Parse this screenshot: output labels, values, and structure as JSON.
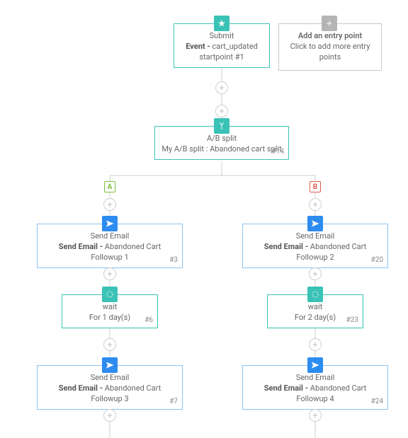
{
  "entry": {
    "title": "Submit",
    "detail_bold": "Event - ",
    "detail_rest": "cart_updated",
    "line3": "startpoint #1"
  },
  "add_entry": {
    "title": "Add an entry point",
    "subtitle": "Click to add more entry points"
  },
  "split": {
    "title": "A/B split",
    "detail": "My A/B split : Abandoned cart split",
    "id": "#14",
    "labelA": "A",
    "labelB": "B"
  },
  "a": {
    "email1": {
      "title": "Send Email",
      "bold": "Send Email - ",
      "rest": "Abandoned Cart Followup 1",
      "id": "#3"
    },
    "wait": {
      "title": "wait",
      "detail": "For 1 day(s)",
      "id": "#6"
    },
    "email2": {
      "title": "Send Email",
      "bold": "Send Email - ",
      "rest": "Abandoned Cart Followup 3",
      "id": "#7"
    }
  },
  "b": {
    "email1": {
      "title": "Send Email",
      "bold": "Send Email - ",
      "rest": "Abandoned Cart Followup 2",
      "id": "#20"
    },
    "wait": {
      "title": "wait",
      "detail": "For 2 day(s)",
      "id": "#23"
    },
    "email2": {
      "title": "Send Email",
      "bold": "Send Email - ",
      "rest": "Abandoned Cart Followup 4",
      "id": "#24"
    }
  }
}
